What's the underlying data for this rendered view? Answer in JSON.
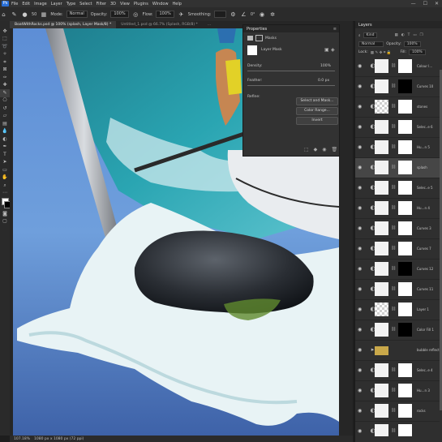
{
  "menu": {
    "logo": "Ps",
    "items": [
      "File",
      "Edit",
      "Image",
      "Layer",
      "Type",
      "Select",
      "Filter",
      "3D",
      "View",
      "Plugins",
      "Window",
      "Help"
    ],
    "window_controls": [
      "—",
      "☐",
      "✕"
    ]
  },
  "options_bar": {
    "mode_label": "Mode:",
    "mode_value": "Normal",
    "opacity_label": "Opacity:",
    "opacity_value": "100%",
    "flow_label": "Flow:",
    "flow_value": "100%",
    "smoothing_label": "Smoothing:",
    "angle_value": "0°",
    "brush_size": "50"
  },
  "tabs": [
    {
      "label": "BoatWithRocks.psd @ 100% (splash, Layer Mask/8) *",
      "active": true
    },
    {
      "label": "Untitled_1.psd @ 66.7% (Splash, RGB/8) *",
      "active": false
    },
    {
      "label": "…",
      "active": false
    }
  ],
  "status": {
    "zoom": "107.18%",
    "doc": "1080 px x 1080 px (72 ppi)"
  },
  "properties": {
    "title": "Properties",
    "section": "Masks",
    "mask_type": "Layer Mask",
    "density_label": "Density:",
    "density_value": "100%",
    "feather_label": "Feather:",
    "feather_value": "0.0 px",
    "refine_label": "Refine:",
    "buttons": [
      "Select and Mask...",
      "Color Range...",
      "Invert"
    ]
  },
  "layers": {
    "title": "Layers",
    "kind_label": "Kind",
    "blend_mode": "Normal",
    "opacity_label": "Opacity:",
    "opacity_value": "100%",
    "lock_label": "Lock:",
    "fill_label": "Fill:",
    "fill_value": "100%",
    "rows": [
      {
        "name": "Colour l…",
        "thumb": "white"
      },
      {
        "name": "Curves 10",
        "thumb": "black"
      },
      {
        "name": "stones",
        "thumb": "check"
      },
      {
        "name": "Selec..e 6",
        "thumb": "white"
      },
      {
        "name": "Hu…n 5",
        "thumb": "white"
      },
      {
        "name": "splash",
        "thumb": "white",
        "active": true
      },
      {
        "name": "Selec..e 5",
        "thumb": "white"
      },
      {
        "name": "Hu…n 4",
        "thumb": "white"
      },
      {
        "name": "Curves 3",
        "thumb": "white"
      },
      {
        "name": "Curves 7",
        "thumb": "white"
      },
      {
        "name": "Curves 12",
        "thumb": "black"
      },
      {
        "name": "Curves 11",
        "thumb": "white"
      },
      {
        "name": "Layer 1",
        "thumb": "check"
      },
      {
        "name": "Color Fill 1",
        "thumb": "black"
      },
      {
        "name": "bubble reflections",
        "thumb": "folder"
      },
      {
        "name": "Selec..e 4",
        "thumb": "white"
      },
      {
        "name": "Hu…n 3",
        "thumb": "white"
      },
      {
        "name": "rocks",
        "thumb": "white"
      },
      {
        "name": "",
        "thumb": "white"
      },
      {
        "name": "ref….y",
        "thumb": "black"
      }
    ]
  },
  "colors": {
    "accent": "#2a6fd6",
    "panel_bg": "#323232",
    "canvas_bg": "#6e9ed8"
  }
}
